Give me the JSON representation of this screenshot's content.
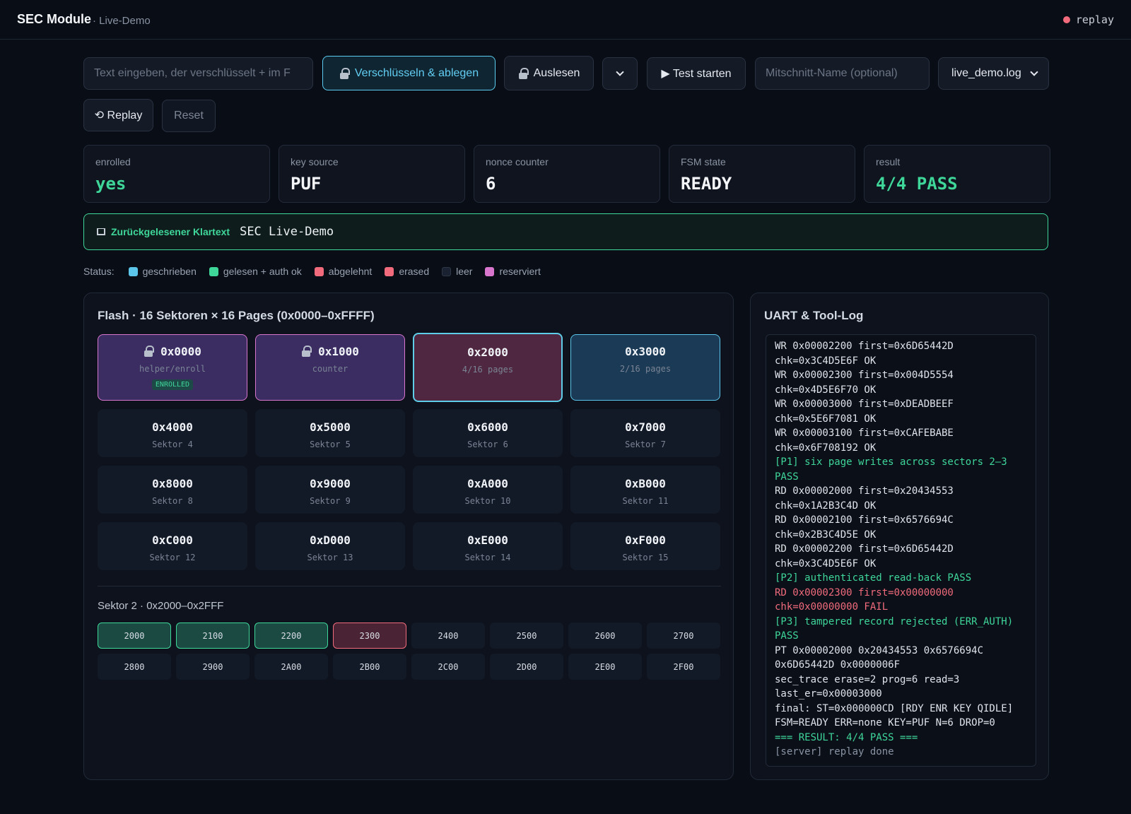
{
  "header": {
    "title": "SEC Module",
    "subtitle": "· Live-Demo",
    "mode_label": "replay"
  },
  "toolbar": {
    "text_input_placeholder": "Text eingeben, der verschlüsselt + im F",
    "encrypt_button": "Verschlüsseln & ablegen",
    "read_button": "Auslesen",
    "test_button": "▶ Test starten",
    "capture_name_placeholder": "Mitschnitt-Name (optional)",
    "log_select_value": "live_demo.log",
    "replay_button": "⟲ Replay",
    "reset_button": "Reset"
  },
  "stats": [
    {
      "label": "enrolled",
      "value": "yes"
    },
    {
      "label": "key source",
      "value": "PUF"
    },
    {
      "label": "nonce counter",
      "value": "6"
    },
    {
      "label": "FSM state",
      "value": "READY"
    },
    {
      "label": "result",
      "value": "4/4 PASS"
    }
  ],
  "readback": {
    "label": "Zurückgelesener Klartext",
    "value": "SEC Live-Demo"
  },
  "legend": {
    "title": "Status:",
    "items": [
      {
        "label": "geschrieben",
        "color": "#5cc6ea"
      },
      {
        "label": "gelesen + auth ok",
        "color": "#3fd69a"
      },
      {
        "label": "abgelehnt",
        "color": "#f16b7c"
      },
      {
        "label": "erased",
        "color": "#f16b7c"
      },
      {
        "label": "leer",
        "color": "#1a2232"
      },
      {
        "label": "reserviert",
        "color": "#d875cc"
      }
    ]
  },
  "flash": {
    "title": "Flash · 16 Sektoren × 16 Pages (0x0000–0xFFFF)",
    "sectors": [
      {
        "addr": "0x0000",
        "sub": "helper/enroll",
        "badge": "ENROLLED"
      },
      {
        "addr": "0x1000",
        "sub": "counter"
      },
      {
        "addr": "0x2000",
        "sub": "4/16 pages"
      },
      {
        "addr": "0x3000",
        "sub": "2/16 pages"
      },
      {
        "addr": "0x4000",
        "sub": "Sektor 4"
      },
      {
        "addr": "0x5000",
        "sub": "Sektor 5"
      },
      {
        "addr": "0x6000",
        "sub": "Sektor 6"
      },
      {
        "addr": "0x7000",
        "sub": "Sektor 7"
      },
      {
        "addr": "0x8000",
        "sub": "Sektor 8"
      },
      {
        "addr": "0x9000",
        "sub": "Sektor 9"
      },
      {
        "addr": "0xA000",
        "sub": "Sektor 10"
      },
      {
        "addr": "0xB000",
        "sub": "Sektor 11"
      },
      {
        "addr": "0xC000",
        "sub": "Sektor 12"
      },
      {
        "addr": "0xD000",
        "sub": "Sektor 13"
      },
      {
        "addr": "0xE000",
        "sub": "Sektor 14"
      },
      {
        "addr": "0xF000",
        "sub": "Sektor 15"
      }
    ],
    "sector_detail_title": "Sektor 2 · 0x2000–0x2FFF",
    "pages": [
      "2000",
      "2100",
      "2200",
      "2300",
      "2400",
      "2500",
      "2600",
      "2700",
      "2800",
      "2900",
      "2A00",
      "2B00",
      "2C00",
      "2D00",
      "2E00",
      "2F00"
    ]
  },
  "log": {
    "title": "UART & Tool-Log",
    "lines": [
      "WR 0x00002200 first=0x6D65442D chk=0x3C4D5E6F OK",
      "WR 0x00002300 first=0x004D5554 chk=0x4D5E6F70 OK",
      "WR 0x00003000 first=0xDEADBEEF chk=0x5E6F7081 OK",
      "WR 0x00003100 first=0xCAFEBABE chk=0x6F708192 OK",
      "[P1] six page writes across sectors 2–3 PASS",
      "RD 0x00002000 first=0x20434553 chk=0x1A2B3C4D OK",
      "RD 0x00002100 first=0x6576694C chk=0x2B3C4D5E OK",
      "RD 0x00002200 first=0x6D65442D chk=0x3C4D5E6F OK",
      "[P2] authenticated read-back PASS",
      "RD 0x00002300 first=0x00000000 chk=0x00000000 FAIL",
      "[P3] tampered record rejected (ERR_AUTH) PASS",
      "PT 0x00002000 0x20434553 0x6576694C 0x6D65442D 0x0000006F",
      "sec_trace erase=2 prog=6 read=3 last_er=0x00003000",
      "final: ST=0x000000CD [RDY ENR KEY QIDLE] FSM=READY ERR=none KEY=PUF N=6 DROP=0",
      "=== RESULT: 4/4 PASS ===",
      "[server] replay done"
    ]
  }
}
